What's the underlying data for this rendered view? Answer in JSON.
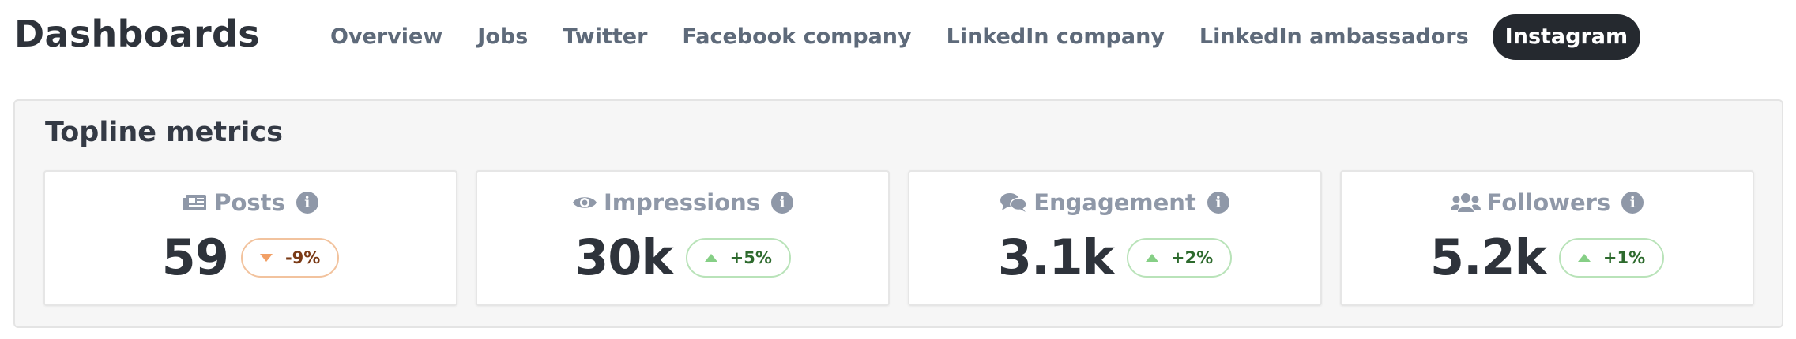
{
  "header": {
    "title": "Dashboards",
    "tabs": [
      {
        "label": "Overview",
        "active": false
      },
      {
        "label": "Jobs",
        "active": false
      },
      {
        "label": "Twitter",
        "active": false
      },
      {
        "label": "Facebook company",
        "active": false
      },
      {
        "label": "LinkedIn company",
        "active": false
      },
      {
        "label": "LinkedIn ambassadors",
        "active": false
      },
      {
        "label": "Instagram",
        "active": true
      }
    ]
  },
  "topline": {
    "title": "Topline metrics",
    "info_glyph": "i",
    "cards": [
      {
        "label": "Posts",
        "icon": "newspaper-icon",
        "value": "59",
        "change": "-9%",
        "direction": "down"
      },
      {
        "label": "Impressions",
        "icon": "eye-icon",
        "value": "30k",
        "change": "+5%",
        "direction": "up"
      },
      {
        "label": "Engagement",
        "icon": "comments-icon",
        "value": "3.1k",
        "change": "+2%",
        "direction": "up"
      },
      {
        "label": "Followers",
        "icon": "users-icon",
        "value": "5.2k",
        "change": "+1%",
        "direction": "up"
      }
    ]
  },
  "colors": {
    "active_tab_bg": "#25292f",
    "negative_border": "#f2c39e",
    "negative_arrow": "#f2a066",
    "positive_border": "#b9e3b9",
    "positive_arrow": "#86cf86",
    "muted_text": "#8f98a8"
  }
}
